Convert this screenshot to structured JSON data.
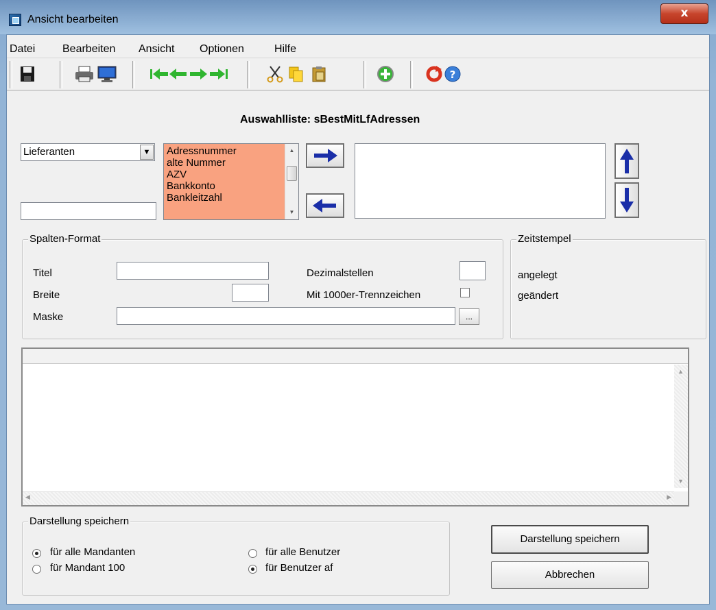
{
  "window": {
    "title": "Ansicht bearbeiten",
    "close_glyph": "x"
  },
  "menu": [
    "Datei",
    "Bearbeiten",
    "Ansicht",
    "Optionen",
    "Hilfe"
  ],
  "list_title": "Auswahlliste: sBestMitLfAdressen",
  "source_combo": {
    "value": "Lieferanten"
  },
  "filter_input": {
    "value": ""
  },
  "available_fields": [
    "Adressnummer",
    "alte Nummer",
    "AZV",
    "Bankkonto",
    "Bankleitzahl"
  ],
  "selected_fields": [],
  "column_format": {
    "group_label": "Spalten-Format",
    "title_label": "Titel",
    "title_value": "",
    "width_label": "Breite",
    "width_value": "",
    "mask_label": "Maske",
    "mask_value": "",
    "mask_button": "...",
    "decimals_label": "Dezimalstellen",
    "decimals_value": "",
    "thousands_label": "Mit 1000er-Trennzeichen",
    "thousands_checked": false
  },
  "timestamp": {
    "group_label": "Zeitstempel",
    "created_label": "angelegt",
    "changed_label": "geändert"
  },
  "save_scope": {
    "group_label": "Darstellung speichern",
    "options": [
      {
        "label": "für alle Mandanten",
        "checked": true
      },
      {
        "label": "für Mandant 100",
        "checked": false
      },
      {
        "label": "für alle Benutzer",
        "checked": false
      },
      {
        "label": "für Benutzer af",
        "checked": true
      }
    ]
  },
  "buttons": {
    "save": "Darstellung speichern",
    "cancel": "Abbrechen"
  },
  "toolbar_icons": [
    "save-icon",
    "print-icon",
    "monitor-icon",
    "first-icon",
    "previous-icon",
    "next-icon",
    "last-icon",
    "cut-icon",
    "copy-icon",
    "paste-icon",
    "add-icon",
    "refresh-icon",
    "help-icon"
  ],
  "colors": {
    "list_highlight": "#f9a280",
    "nav_green": "#2fb52f",
    "arrow_blue": "#1a2ea8"
  }
}
